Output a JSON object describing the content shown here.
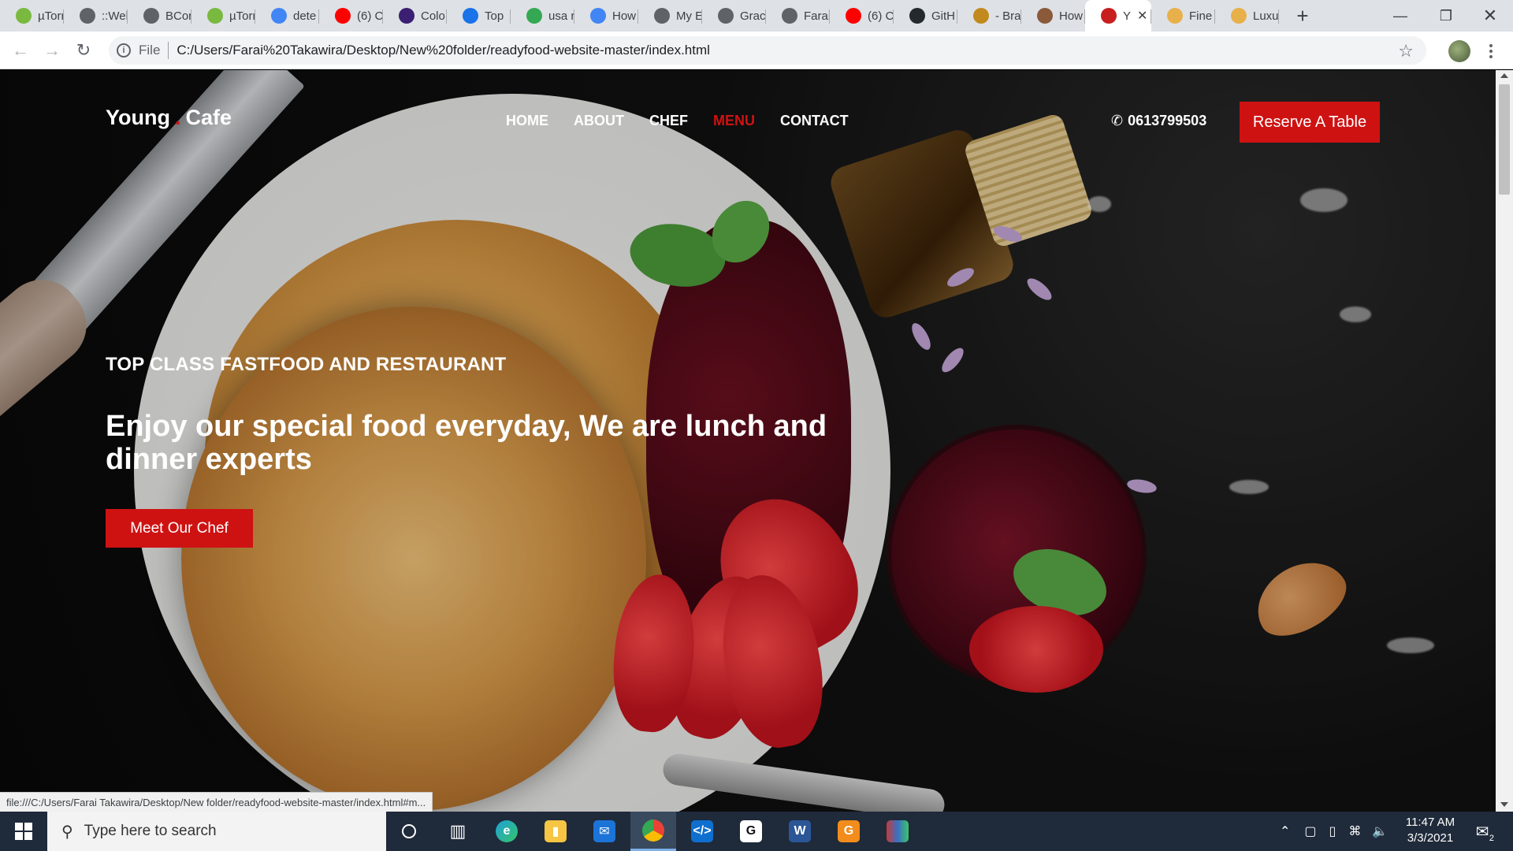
{
  "browser": {
    "tabs": [
      {
        "label": "µTorr",
        "icon": "utorrent-icon",
        "color": "#79b93f"
      },
      {
        "label": "::Wel",
        "icon": "globe-icon",
        "color": "#5f6368"
      },
      {
        "label": "BCor",
        "icon": "globe-icon",
        "color": "#5f6368"
      },
      {
        "label": "µTorr",
        "icon": "utorrent-icon",
        "color": "#79b93f"
      },
      {
        "label": "dete",
        "icon": "google-icon",
        "color": "#4285f4"
      },
      {
        "label": "(6) C",
        "icon": "youtube-icon",
        "color": "#ff0000"
      },
      {
        "label": "Colo",
        "icon": "color-icon",
        "color": "#3b1f72"
      },
      {
        "label": "Top",
        "icon": "dictionary-icon",
        "color": "#1a73e8"
      },
      {
        "label": "usa r",
        "icon": "maps-icon",
        "color": "#34a853"
      },
      {
        "label": "How",
        "icon": "google-icon",
        "color": "#4285f4"
      },
      {
        "label": "My E",
        "icon": "globe-icon",
        "color": "#5f6368"
      },
      {
        "label": "Grac",
        "icon": "globe-icon",
        "color": "#5f6368"
      },
      {
        "label": "Farai",
        "icon": "globe-icon",
        "color": "#5f6368"
      },
      {
        "label": "(6) C",
        "icon": "youtube-icon",
        "color": "#ff0000"
      },
      {
        "label": "GitH",
        "icon": "github-icon",
        "color": "#24292e"
      },
      {
        "label": "- Bra",
        "icon": "book-icon",
        "color": "#c28a1e"
      },
      {
        "label": "How",
        "icon": "face-icon",
        "color": "#8a5a3a"
      },
      {
        "label": "Y",
        "icon": "cafe-icon",
        "color": "#c81e1e"
      },
      {
        "label": "Fine",
        "icon": "upload-icon",
        "color": "#e8b04a"
      },
      {
        "label": "Luxu",
        "icon": "upload-icon",
        "color": "#e8b04a"
      }
    ],
    "active_tab_index": 17,
    "url_scheme": "File",
    "url": "C:/Users/Farai%20Takawira/Desktop/New%20folder/readyfood-website-master/index.html",
    "status_link": "file:///C:/Users/Farai Takawira/Desktop/New folder/readyfood-website-master/index.html#m..."
  },
  "site": {
    "logo_left": "Young",
    "logo_dot": ".",
    "logo_right": "Cafe",
    "nav": [
      "HOME",
      "ABOUT",
      "CHEF",
      "MENU",
      "CONTACT"
    ],
    "active_nav": "MENU",
    "phone": "0613799503",
    "reserve_label": "Reserve A Table",
    "subtitle": "TOP CLASS FASTFOOD AND RESTAURANT",
    "headline": "Enjoy our special food everyday, We are lunch and dinner experts",
    "cta_label": "Meet Our Chef",
    "accent_color": "#ce1212"
  },
  "taskbar": {
    "search_placeholder": "Type here to search",
    "apps": [
      "cortana-icon",
      "task-view-icon",
      "edge-icon",
      "file-explorer-icon",
      "mail-icon",
      "chrome-icon",
      "vscode-icon",
      "grammarly-icon",
      "word-icon",
      "pdf-icon",
      "winrar-icon"
    ],
    "active_app": "chrome-icon",
    "time": "11:47 AM",
    "date": "3/3/2021",
    "notifications": "2"
  }
}
